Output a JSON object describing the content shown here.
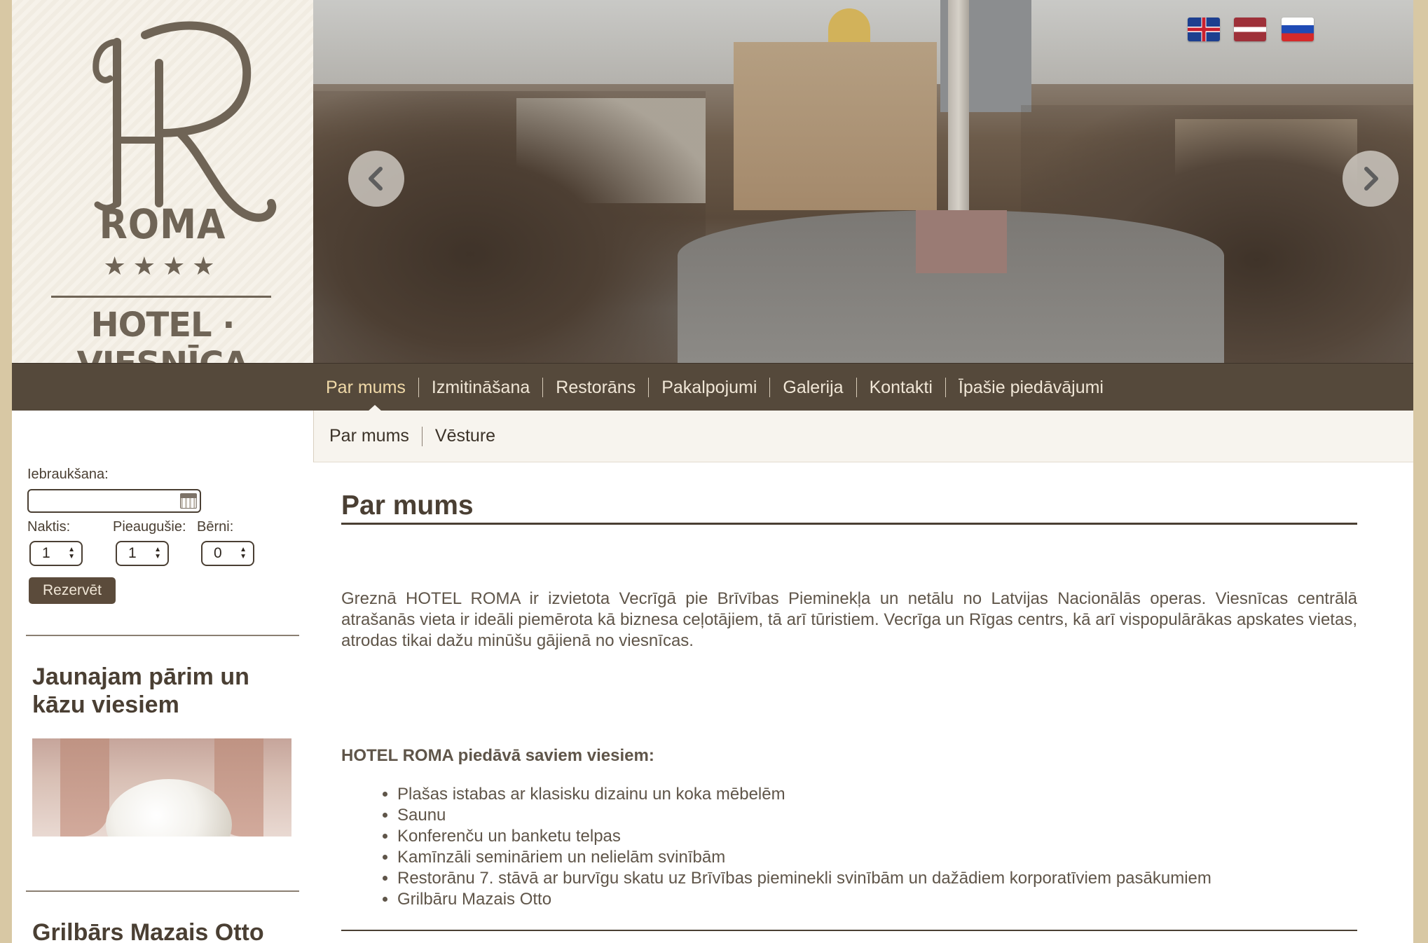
{
  "brand": {
    "logo_letters": "HR",
    "logo_name": "ROMA",
    "stars": "★★★★",
    "logo_subtitle": "HOTEL · VIESNĪCA"
  },
  "languages": [
    {
      "code": "en",
      "icon": "uk-flag-icon"
    },
    {
      "code": "lv",
      "icon": "latvia-flag-icon"
    },
    {
      "code": "ru",
      "icon": "russia-flag-icon"
    }
  ],
  "slider": {
    "prev_icon": "chevron-left-icon",
    "next_icon": "chevron-right-icon"
  },
  "nav": {
    "items": [
      "Par mums",
      "Izmitināšana",
      "Restorāns",
      "Pakalpojumi",
      "Galerija",
      "Kontakti",
      "Īpašie piedāvājumi"
    ],
    "active": "Par mums"
  },
  "subnav": {
    "items": [
      "Par mums",
      "Vēsture"
    ]
  },
  "booking": {
    "checkin_label": "Iebraukšana:",
    "checkin_value": "",
    "nights_label": "Naktis:",
    "adults_label": "Pieaugušie:",
    "children_label": "Bērni:",
    "nights_value": "1",
    "adults_value": "1",
    "children_value": "0",
    "reserve_label": "Rezervēt"
  },
  "sidebar": {
    "promo1_title": "Jaunajam pārim un kāzu viesiem",
    "promo2_title": "Grilbārs Mazais Otto"
  },
  "main": {
    "title": "Par mums",
    "intro": "Greznā HOTEL ROMA ir izvietota Vecrīgā pie Brīvības Pieminekļa un netālu no Latvijas Nacionālās operas. Viesnīcas centrālā atrašanās vieta ir ideāli piemērota kā biznesa ceļotājiem, tā arī tūristiem. Vecrīga un Rīgas centrs, kā arī vispopulārākas apskates vietas, atrodas tikai dažu minūšu gājienā no viesnīcas.",
    "offer_title": "HOTEL ROMA piedāvā saviem viesiem:",
    "offer_items": [
      "Plašas istabas ar klasisku dizainu un koka mēbelēm",
      "Saunu",
      "Konferenču un banketu telpas",
      "Kamīnzāli semināriem un nelielām svinībām",
      "Restorānu 7. stāvā ar burvīgu skatu uz Brīvības pieminekli svinībām un dažādiem korporatīviem pasākumiem",
      "Grilbāru Mazais Otto"
    ]
  },
  "colors": {
    "outer_bg": "#d8c8a4",
    "nav_bg": "#55493b",
    "text_dark": "#4a3f33",
    "button_bg": "#5b4b3b",
    "subnav_bg": "#f7f4ee"
  }
}
